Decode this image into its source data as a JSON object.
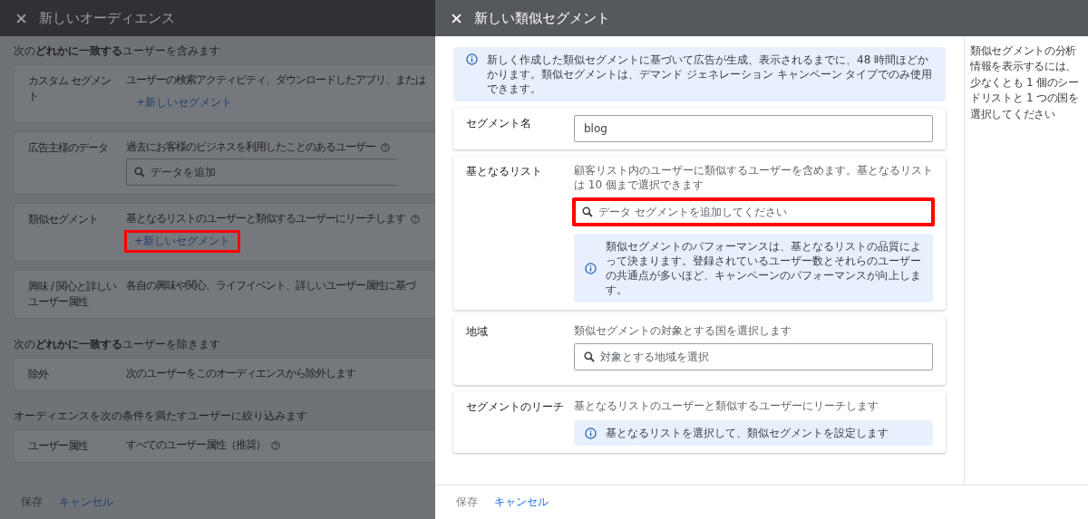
{
  "background_page": {
    "title": "新しいオーディエンス",
    "sections": [
      {
        "heading": "次の**どれかに一致する**ユーザーを含みます",
        "segments": [
          {
            "label": "カスタム セグメント",
            "description": "ユーザーの検索アクティビティ、ダウンロードしたアプリ、または",
            "help": false,
            "kind": "link",
            "action": "+新しいセグメント",
            "highlighted": false
          },
          {
            "label": "広告主様のデータ",
            "description": "過去にお客様のビジネスを利用したことのあるユーザー",
            "help": true,
            "kind": "search",
            "placeholder": "データを追加"
          },
          {
            "label": "類似セグメント",
            "description": "基となるリストのユーザーと類似するユーザーにリーチします",
            "help": true,
            "kind": "link",
            "action": "+新しいセグメント",
            "highlighted": true
          },
          {
            "label": "興味 / 関心と詳しいユーザー属性",
            "description": "各自の興味や関心、ライフイベント、詳しいユーザー属性に基づ",
            "help": false,
            "kind": "text"
          }
        ]
      },
      {
        "heading": "次の**どれかに一致する**ユーザーを除きます",
        "segments": [
          {
            "label": "除外",
            "description": "次のユーザーをこのオーディエンスから除外します",
            "help": false,
            "kind": "text"
          }
        ]
      },
      {
        "heading": "オーディエンスを次の条件を満たすユーザーに絞り込みます",
        "segments": [
          {
            "label": "ユーザー属性",
            "description": "すべてのユーザー属性（推奨）",
            "help": true,
            "kind": "text"
          }
        ]
      }
    ],
    "footer": {
      "save": "保存",
      "cancel": "キャンセル"
    }
  },
  "dialog": {
    "title": "新しい類似セグメント",
    "notice": "新しく作成した類似セグメントに基づいて広告が生成、表示されるまでに、48 時間ほどかかります。類似セグメントは、デマンド ジェネレーション キャンペーン タイプでのみ使用できます。",
    "fields": [
      {
        "label": "セグメント名",
        "kind": "input",
        "value": "blog"
      },
      {
        "label": "基となるリスト",
        "kind": "search",
        "description": "顧客リスト内のユーザーに類似するユーザーを含めます。基となるリストは 10 個まで選択できます",
        "placeholder": "データ セグメントを追加してください",
        "highlighted": true,
        "info": "類似セグメントのパフォーマンスは、基となるリストの品質によって決まります。登録されているユーザー数とそれらのユーザーの共通点が多いほど、キャンペーンのパフォーマンスが向上します。"
      },
      {
        "label": "地域",
        "kind": "search",
        "description": "類似セグメントの対象とする国を選択します",
        "placeholder": "対象とする地域を選択",
        "highlighted": false
      },
      {
        "label": "セグメントのリーチ",
        "kind": "info",
        "description": "基となるリストのユーザーと類似するユーザーにリーチします",
        "info": "基となるリストを選択して、類似セグメントを設定します"
      }
    ],
    "side_note": "類似セグメントの分析情報を表示するには、少なくとも 1 個のシードリストと 1 つの国を選択してください",
    "footer": {
      "save": "保存",
      "cancel": "キャンセル"
    }
  }
}
